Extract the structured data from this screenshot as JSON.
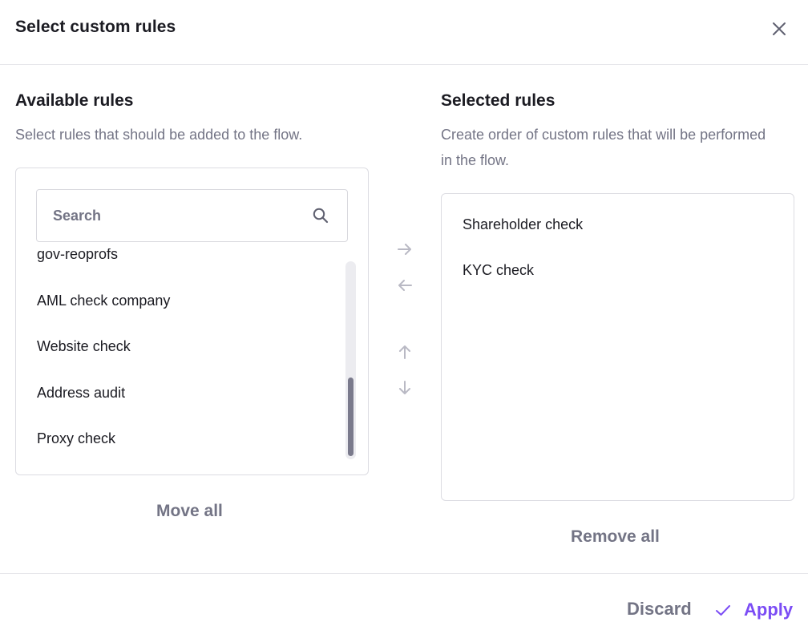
{
  "dialog": {
    "title": "Select custom rules",
    "close_icon": "close-icon"
  },
  "available": {
    "title": "Available rules",
    "description": "Select rules that should be added to the flow.",
    "search": {
      "placeholder": "Search",
      "value": "",
      "icon": "search-icon"
    },
    "items": [
      {
        "label": "gov-reoprofs"
      },
      {
        "label": "AML check company"
      },
      {
        "label": "Website check"
      },
      {
        "label": "Address audit"
      },
      {
        "label": "Proxy check"
      }
    ],
    "move_all_label": "Move all"
  },
  "controls": {
    "move_right_icon": "arrow-right-icon",
    "move_left_icon": "arrow-left-icon",
    "move_up_icon": "arrow-up-icon",
    "move_down_icon": "arrow-down-icon"
  },
  "selected": {
    "title": "Selected rules",
    "description": "Create order of custom rules that will be performed in the flow.",
    "items": [
      {
        "label": "Shareholder check"
      },
      {
        "label": "KYC check"
      }
    ],
    "remove_all_label": "Remove all"
  },
  "footer": {
    "discard_label": "Discard",
    "apply_label": "Apply",
    "apply_icon": "check-icon"
  },
  "colors": {
    "accent": "#7b4cf5",
    "muted": "#737485",
    "text": "#1b1b22",
    "border": "#dcdce2",
    "arrow_disabled": "#b9b9c4"
  }
}
